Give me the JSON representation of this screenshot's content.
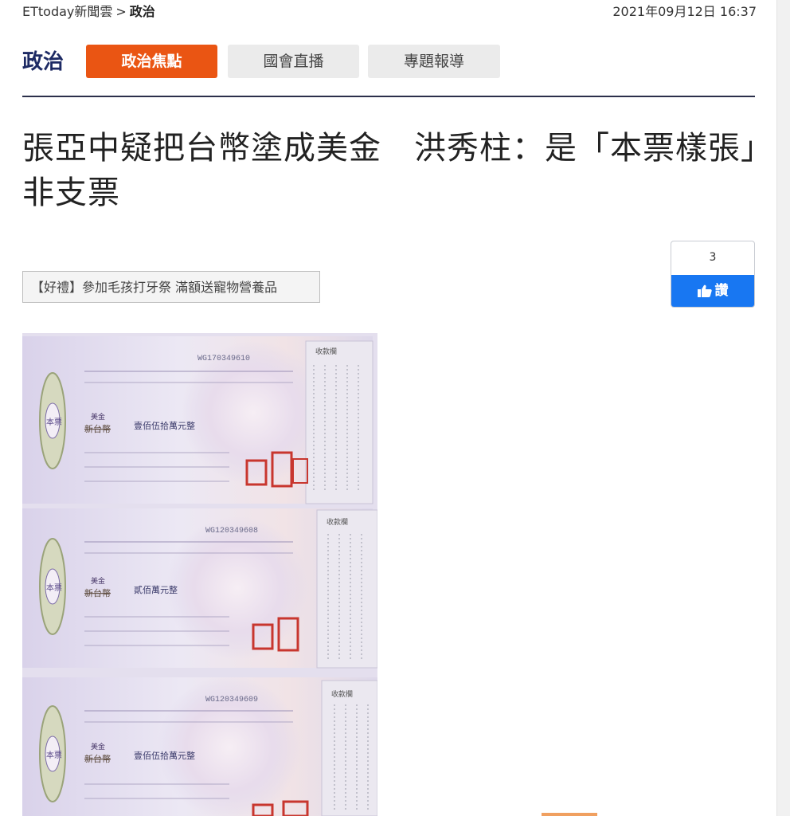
{
  "breadcrumb": {
    "site": "ETtoday新聞雲",
    "separator": ">",
    "category": "政治",
    "datetime": "2021年09月12日 16:37"
  },
  "section": {
    "title": "政治",
    "tabs": [
      {
        "label": "政治焦點",
        "active": true
      },
      {
        "label": "國會直播",
        "active": false
      },
      {
        "label": "專題報導",
        "active": false
      }
    ]
  },
  "article": {
    "headline": "張亞中疑把台幣塗成美金　洪秀柱：是「本票樣張」非支票"
  },
  "promo": {
    "text": "【好禮】參加毛孩打牙祭 滿額送寵物營養品"
  },
  "like_widget": {
    "count": "3",
    "button_label": "讚",
    "icon": "thumbs-up-icon"
  },
  "photo": {
    "cheques": [
      {
        "serial": "WG170349610",
        "currency_original": "新台幣",
        "currency_handwritten": "美金",
        "amount_words": "壹佰伍拾萬元整",
        "side_label": "本票",
        "stub_label": "收款欄"
      },
      {
        "serial": "WG120349608",
        "currency_original": "新台幣",
        "currency_handwritten": "美金",
        "amount_words": "貳佰萬元整",
        "side_label": "本票",
        "stub_label": "收款欄"
      },
      {
        "serial": "WG120349609",
        "currency_original": "新台幣",
        "currency_handwritten": "美金",
        "amount_words": "壹佰伍拾萬元整",
        "side_label": "本票",
        "stub_label": "收款欄"
      }
    ]
  },
  "colors": {
    "accent": "#ea5513",
    "section_title": "#1d2a64",
    "divider": "#2b2f4a",
    "facebook_blue": "#1877f2",
    "tab_inactive_bg": "#ebebeb",
    "cheque_bg": "#e6e1f0",
    "stamp_red": "#c8362e"
  }
}
